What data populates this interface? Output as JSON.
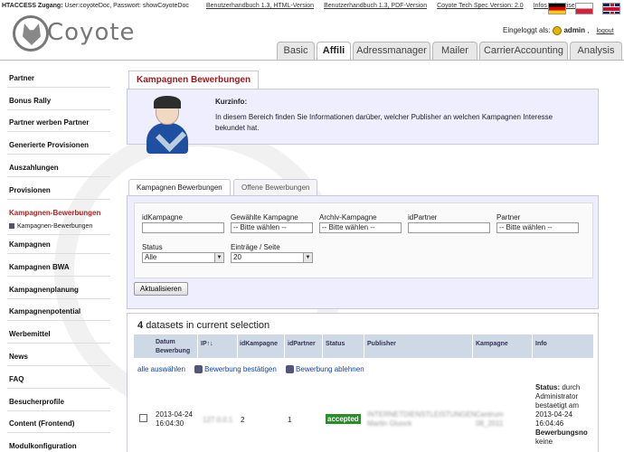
{
  "topbar": {
    "htaccess_label": "HTACCESS Zugang:",
    "user_text": "User:coyoteDoc, Passwort: showCoyoteDoc",
    "links": [
      "Benutzerhandbuch 1.3, HTML-Version",
      "Benutzerhandbuch 1.3, PDF-Version",
      "Coyote Tech Spec Version: 2.0",
      "Infos Advertiser"
    ]
  },
  "header": {
    "logo_text": "Coyote",
    "logged_in_label": "Eingeloggt als:",
    "username": "admin",
    "logout": "logout"
  },
  "tabs": [
    "Basic",
    "Affili",
    "Adressmanager",
    "Mailer",
    "CarrierAccounting",
    "Analysis"
  ],
  "sidebar": {
    "items": [
      "Partner",
      "Bonus Rally",
      "Partner werben Partner",
      "Generierte Provisionen",
      "Auszahlungen",
      "Provisionen",
      "Kampagnen-Bewerbungen",
      "Kampagnen",
      "Kampagnen BWA",
      "Kampagnenplanung",
      "Kampagnenpotential",
      "Werbemittel",
      "News",
      "FAQ",
      "Besucherprofile",
      "Content (Frontend)",
      "Modulkonfiguration"
    ],
    "sub_item": "Kampagnen-Bewerbungen"
  },
  "page": {
    "title": "Kampagnen Bewerbungen",
    "info_title": "Kurzinfo:",
    "info_text": "In diesem Bereich finden Sie Informationen darüber, welcher Publisher an welchen Kampagnen Interesse bekundet hat."
  },
  "subtabs": [
    "Kampagnen Bewerbungen",
    "Offene Bewerbungen"
  ],
  "filters": {
    "idKampagne": {
      "label": "idKampagne",
      "value": ""
    },
    "gewaehlte": {
      "label": "Gewählte Kampagne",
      "value": "-- Bitte wählen --"
    },
    "archiv": {
      "label": "Archiv-Kampagne",
      "value": "-- Bitte wählen --"
    },
    "idPartner": {
      "label": "idPartner",
      "value": ""
    },
    "partner": {
      "label": "Partner",
      "value": "-- Bitte wählen --"
    },
    "status": {
      "label": "Status",
      "value": "Alle"
    },
    "eintraege": {
      "label": "Einträge / Seite",
      "value": "20"
    },
    "update_button": "Aktualisieren"
  },
  "results": {
    "count": "4",
    "count_text": "datasets in current selection",
    "headers": [
      "Datum Bewerbung",
      "IP",
      "idKampagne",
      "idPartner",
      "Status",
      "Publisher",
      "Kampagne",
      "Info"
    ],
    "ip_sort": "↑↓",
    "actions": [
      "alle auswählen",
      "Bewerbung bestätigen",
      "Bewerbung ablehnen"
    ],
    "rows": [
      {
        "datum": "2013-04-24 16:04:30",
        "ip": "127.0.0.1",
        "idKampagne": "2",
        "idPartner": "1",
        "status": "accepted",
        "publisher": "INTERNETDIENSTLEISTUNGEN Martin Gluock",
        "kampagne": "Centrum 08_2011",
        "info_status_label": "Status:",
        "info_status_text": "durch Administrator bestaetigt am 2013-04-24 16:04:46",
        "info_extra": "Bewerbungsno",
        "info_extra2": "keine"
      }
    ]
  }
}
